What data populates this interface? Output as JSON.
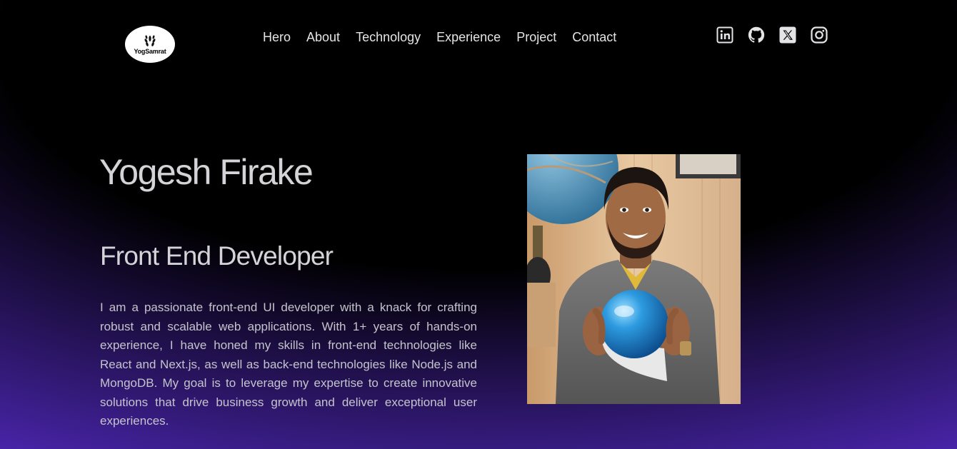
{
  "brand": {
    "logo_text": "YogSamrat"
  },
  "nav": {
    "items": [
      {
        "label": "Hero"
      },
      {
        "label": "About"
      },
      {
        "label": "Technology"
      },
      {
        "label": "Experience"
      },
      {
        "label": "Project"
      },
      {
        "label": "Contact"
      }
    ]
  },
  "social": [
    {
      "icon": "linkedin-icon"
    },
    {
      "icon": "github-icon"
    },
    {
      "icon": "x-twitter-icon"
    },
    {
      "icon": "instagram-icon"
    }
  ],
  "hero": {
    "name": "Yogesh Firake",
    "role": "Front End Developer",
    "bio": "I am a passionate front-end UI developer with a knack for crafting robust and scalable web applications. With 1+ years of hands-on experience, I have honed my skills in front-end technologies like React and Next.js, as well as back-end technologies like Node.js and MongoDB. My goal is to leverage my expertise to create innovative solutions that drive business growth and deliver exceptional user experiences."
  },
  "colors": {
    "background": "#000000",
    "gradient_accent": "#6633ee",
    "text": "#d4d4d8",
    "logo_bg": "#ffffff"
  }
}
